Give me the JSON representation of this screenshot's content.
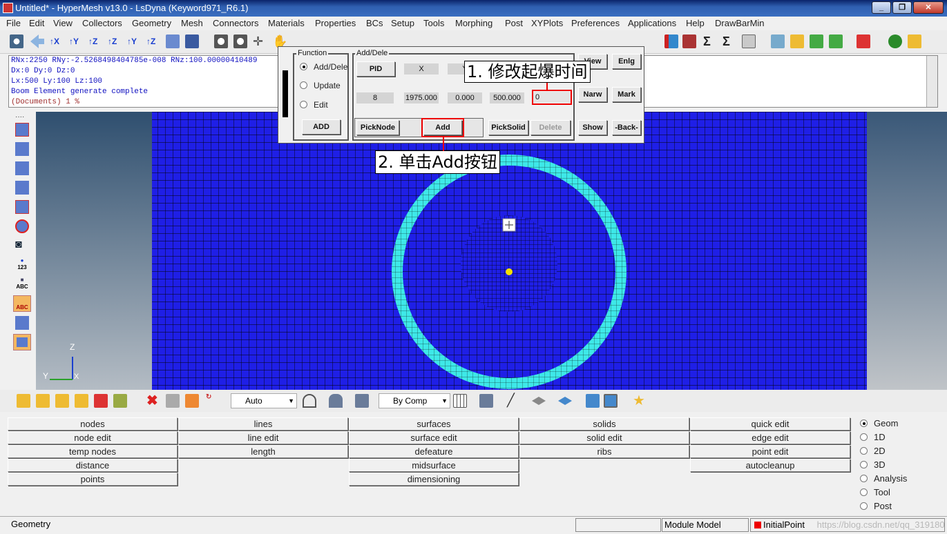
{
  "window": {
    "title": "Untitled* - HyperMesh v13.0 - LsDyna (Keyword971_R6.1)",
    "min": "_",
    "restore": "❐",
    "close": "✕"
  },
  "menu": [
    "File",
    "Edit",
    "View",
    "Collectors",
    "Geometry",
    "Mesh",
    "Connectors",
    "Materials",
    "Properties",
    "BCs",
    "Setup",
    "Tools",
    "Morphing",
    "Post",
    "XYPlots",
    "Preferences",
    "Applications",
    "Help",
    "DrawBarMin"
  ],
  "command": {
    "lines": [
      "RNx:2250 RNy:-2.5268498404785e-008 RNz:100.00000410489",
      "Dx:0 Dy:0 Dz:0",
      "Lx:500 Ly:100 Lz:100",
      "Boom Element generate complete"
    ],
    "last": "(Documents) 1 %"
  },
  "dialog": {
    "function_label": "Function",
    "radios": [
      "Add/Dele",
      "Update",
      "Edit"
    ],
    "selected": "Add/Dele",
    "add_button": "ADD",
    "adddele_label": "Add/Dele",
    "pid_button": "PID",
    "x_label": "X",
    "y_label": "Y",
    "values": [
      "8",
      "1975.000",
      "0.000",
      "500.000"
    ],
    "time_value": "0",
    "picknode": "PickNode",
    "add": "Add",
    "picksolid": "PickSolid",
    "delete": "Delete",
    "view": "View",
    "enlg": "Enlg",
    "narw": "Narw",
    "mark": "Mark",
    "show": "Show",
    "back": "-Back-"
  },
  "annotations": {
    "step1": "1. 修改起爆时间",
    "step2": "2. 单击Add按钮"
  },
  "axes": {
    "z": "Z",
    "y": "Y",
    "x": "X"
  },
  "lefttool": {
    "abc1": "ABC",
    "num": "123",
    "abc2": "ABC"
  },
  "bottom_toolbar": {
    "auto": "Auto",
    "bycomp": "By Comp"
  },
  "panel": {
    "col1": [
      "nodes",
      "node edit",
      "temp nodes",
      "distance",
      "points"
    ],
    "col2": [
      "lines",
      "line edit",
      "length"
    ],
    "col3": [
      "surfaces",
      "surface edit",
      "defeature",
      "midsurface",
      "dimensioning"
    ],
    "col4": [
      "solids",
      "solid edit",
      "ribs"
    ],
    "col5": [
      "quick edit",
      "edge edit",
      "point edit",
      "autocleanup"
    ],
    "radios": [
      "Geom",
      "1D",
      "2D",
      "3D",
      "Analysis",
      "Tool",
      "Post"
    ],
    "selected": "Geom"
  },
  "status": {
    "left": "Geometry",
    "module": "Module Model",
    "point": "InitialPoint",
    "watermark": "https://blog.csdn.net/qq_31918048"
  },
  "colors": {
    "mesh": "#1f1fe6",
    "ring": "#3ee8e8",
    "highlight": "#e00000"
  }
}
